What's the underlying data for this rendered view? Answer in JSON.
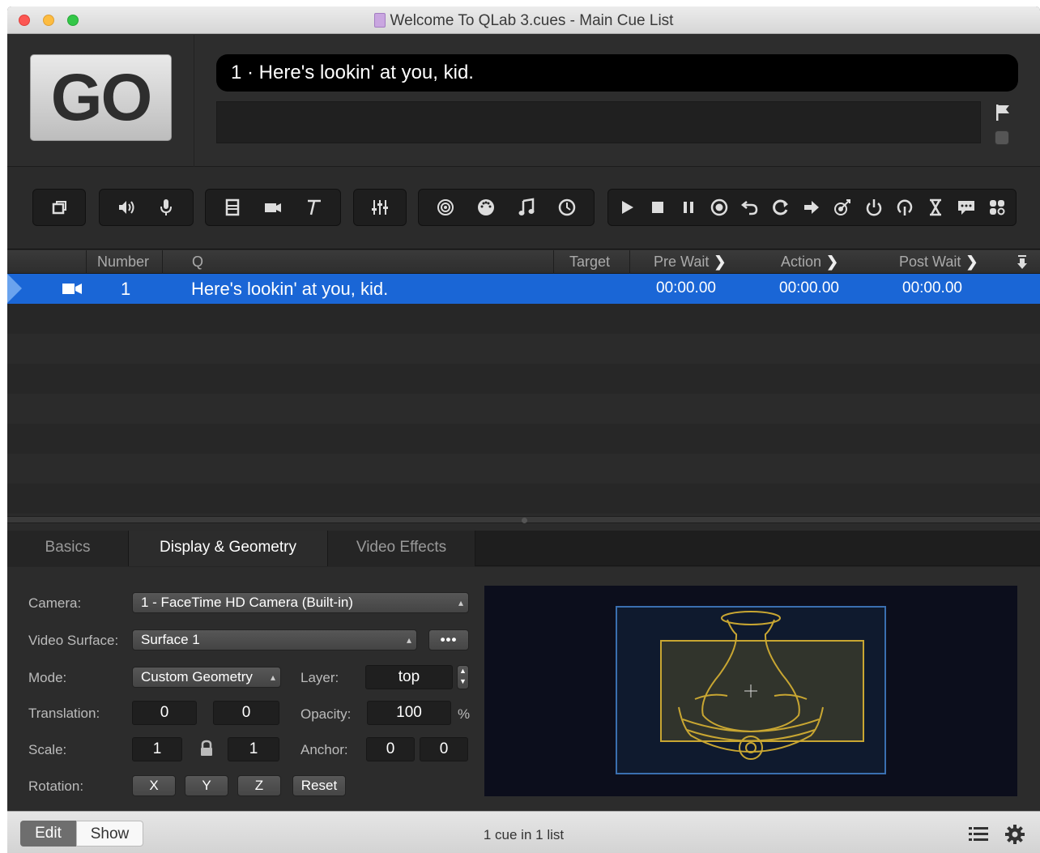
{
  "window": {
    "title": "Welcome To QLab 3.cues - Main Cue List"
  },
  "go": {
    "label": "GO"
  },
  "standby": {
    "text": "1 · Here's lookin' at you, kid."
  },
  "toolbar": {
    "icons": [
      "group-cue-icon",
      "audio-cue-icon",
      "mic-cue-icon",
      "video-cue-icon",
      "camera-cue-icon",
      "text-cue-icon",
      "fade-cue-icon",
      "network-cue-icon",
      "midi-cue-icon",
      "midi-file-cue-icon",
      "timecode-cue-icon",
      "start-cue-icon",
      "stop-cue-icon",
      "pause-cue-icon",
      "load-cue-icon",
      "reset-cue-icon",
      "devamp-cue-icon",
      "goto-cue-icon",
      "target-cue-icon",
      "arm-cue-icon",
      "disarm-cue-icon",
      "wait-cue-icon",
      "memo-cue-icon",
      "script-cue-icon"
    ]
  },
  "columns": {
    "number": "Number",
    "q": "Q",
    "target": "Target",
    "pre_wait": "Pre Wait",
    "action": "Action",
    "post_wait": "Post Wait"
  },
  "cues": [
    {
      "type_icon": "camera-cue-icon",
      "number": "1",
      "q": "Here's lookin' at you, kid.",
      "pre_wait": "00:00.00",
      "action": "00:00.00",
      "post_wait": "00:00.00",
      "selected": true
    }
  ],
  "inspector": {
    "tabs": [
      "Basics",
      "Display & Geometry",
      "Video Effects"
    ],
    "active_tab": "Display & Geometry",
    "labels": {
      "camera": "Camera:",
      "video_surface": "Video Surface:",
      "mode": "Mode:",
      "layer": "Layer:",
      "translation": "Translation:",
      "opacity": "Opacity:",
      "scale": "Scale:",
      "anchor": "Anchor:",
      "rotation": "Rotation:"
    },
    "camera": "1 - FaceTime HD Camera (Built-in)",
    "video_surface": "Surface 1",
    "more_button": "•••",
    "mode": "Custom Geometry",
    "layer": "top",
    "translation_x": "0",
    "translation_y": "0",
    "opacity": "100",
    "opacity_unit": "%",
    "scale_x": "1",
    "scale_y": "1",
    "anchor_x": "0",
    "anchor_y": "0",
    "rotation_buttons": [
      "X",
      "Y",
      "Z"
    ],
    "reset": "Reset"
  },
  "statusbar": {
    "edit": "Edit",
    "show": "Show",
    "status": "1 cue in 1 list"
  },
  "colors": {
    "selection": "#1a66d6",
    "background": "#2b2b2b",
    "preview_outline": "#c8a632",
    "surface_outline": "#3a6fb0"
  }
}
